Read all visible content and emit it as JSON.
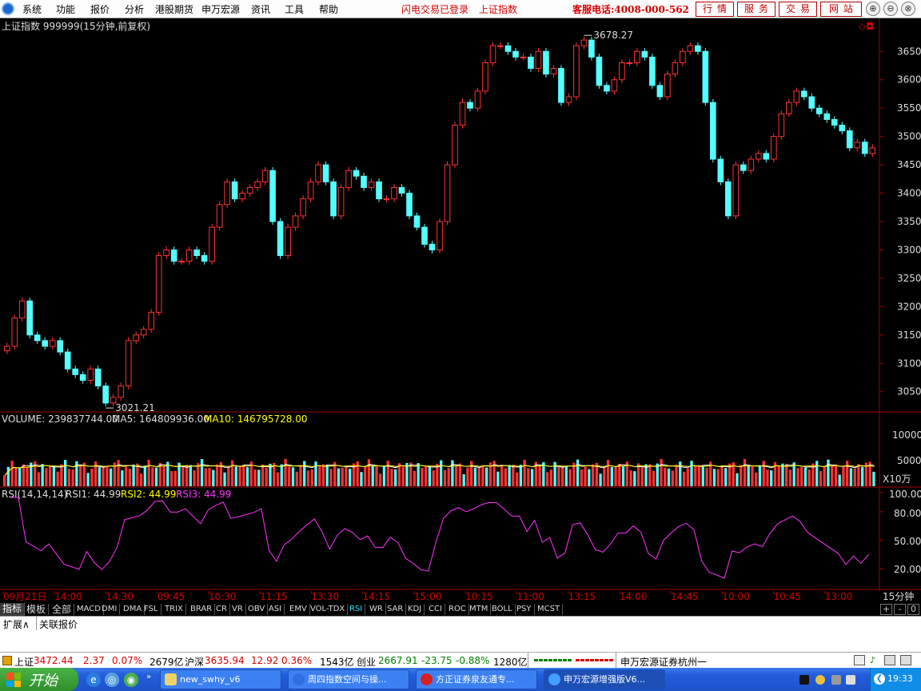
{
  "menu": {
    "items": [
      "系统",
      "功能",
      "报价",
      "分析",
      "港股期货",
      "申万宏源",
      "资讯",
      "工具",
      "帮助"
    ],
    "status_login": "闪电交易已登录",
    "status_index": "上证指数",
    "hotline": "客服电话:4008-000-562",
    "buttons": [
      "行情",
      "服务",
      "交易",
      "网站"
    ],
    "window_controls": [
      "⊕",
      "⊖",
      "⊗"
    ]
  },
  "chart_header": {
    "title": "上证指数 999999(15分钟,前复权)",
    "corner_icons": "◇◘"
  },
  "volume_header": {
    "label": "VOLUME: 239837744.00",
    "ma5": "MA5: 164809936.00",
    "ma10": "MA10: 146795728.00",
    "unit": "X10万",
    "ticks": [
      "10000",
      "5000"
    ]
  },
  "rsi_header": {
    "label": "RSI(14,14,14)",
    "rsi1": "RSI1: 44.99",
    "rsi2": "RSI2: 44.99",
    "rsi3": "RSI3: 44.99",
    "ticks": [
      "100.00",
      "80.00",
      "50.00",
      "20.00"
    ]
  },
  "time_axis": {
    "labels": [
      "09月21日",
      "14:00",
      "14:30",
      "09:45",
      "10:30",
      "11:15",
      "13:30",
      "14:15",
      "15:00",
      "10:15",
      "11:00",
      "13:15",
      "14:00",
      "14:45",
      "10:00",
      "10:45",
      "13:00"
    ],
    "period": "15分钟"
  },
  "indicator_tabs": [
    "指标",
    "模板",
    "全部",
    "MACD",
    "DMI",
    "DMA",
    "FSL",
    "TRIX",
    "BRAR",
    "CR",
    "VR",
    "OBV",
    "ASI",
    "EMV",
    "VOL-TDX",
    "RSI",
    "WR",
    "SAR",
    "KDJ",
    "CCI",
    "ROC",
    "MTM",
    "BOLL",
    "PSY",
    "MCST"
  ],
  "active_indicator": "RSI",
  "pager": [
    "+",
    "-",
    "0"
  ],
  "info_tabs": [
    "扩展∧",
    "关联报价"
  ],
  "status_bar": {
    "sh_label": "上证",
    "sh_value": "3472.44",
    "sh_change": "2.37",
    "sh_pct": "0.07%",
    "sh_amount": "2679亿",
    "hs_label": "沪深",
    "hs_value": "3635.94",
    "hs_change": "12.92",
    "hs_pct": "0.36%",
    "hs_amount": "1543亿",
    "cy_label": "创业",
    "cy_value": "2667.91",
    "cy_change": "-23.75",
    "cy_pct": "-0.88%",
    "cy_amount": "1280亿",
    "broker": "申万宏源证券杭州一"
  },
  "taskbar": {
    "start": "开始",
    "tasks": [
      "new_swhy_v6",
      "周四指数空间与操...",
      "方正证券泉友通专...",
      "申万宏源增强版V6..."
    ],
    "clock": "19:33"
  },
  "chart_data": {
    "type": "line",
    "title": "上证指数 999999(15分钟,前复权)",
    "ylim": [
      3020,
      3680
    ],
    "yticks": [
      3050,
      3100,
      3150,
      3200,
      3250,
      3300,
      3350,
      3400,
      3450,
      3500,
      3550,
      3600,
      3650
    ],
    "grid": false,
    "annotations": [
      {
        "text": "3678.27",
        "value": 3678.27
      },
      {
        "text": "3021.21",
        "value": 3021.21
      }
    ],
    "series": [
      {
        "values": [
          3130,
          3180,
          3210,
          3150,
          3140,
          3130,
          3140,
          3120,
          3090,
          3080,
          3070,
          3090,
          3060,
          3030,
          3040,
          3060,
          3140,
          3150,
          3160,
          3190,
          3290,
          3300,
          3280,
          3280,
          3300,
          3290,
          3280,
          3340,
          3380,
          3420,
          3390,
          3400,
          3410,
          3420,
          3440,
          3350,
          3290,
          3340,
          3360,
          3390,
          3420,
          3450,
          3420,
          3360,
          3410,
          3440,
          3430,
          3410,
          3420,
          3390,
          3390,
          3410,
          3400,
          3360,
          3340,
          3310,
          3300,
          3350,
          3450,
          3520,
          3560,
          3550,
          3580,
          3630,
          3660,
          3660,
          3650,
          3640,
          3640,
          3620,
          3650,
          3610,
          3620,
          3560,
          3570,
          3660,
          3670,
          3640,
          3590,
          3580,
          3600,
          3630,
          3630,
          3650,
          3640,
          3590,
          3570,
          3610,
          3630,
          3650,
          3660,
          3650,
          3560,
          3460,
          3420,
          3360,
          3450,
          3440,
          3460,
          3470,
          3460,
          3500,
          3540,
          3560,
          3580,
          3570,
          3550,
          3540,
          3530,
          3520,
          3510,
          3480,
          3490,
          3470,
          3480
        ]
      }
    ],
    "volume": {
      "ylim": [
        0,
        11500
      ]
    },
    "rsi": {
      "ylim": [
        0,
        100
      ],
      "levels": [
        20,
        50,
        80,
        100
      ]
    }
  }
}
